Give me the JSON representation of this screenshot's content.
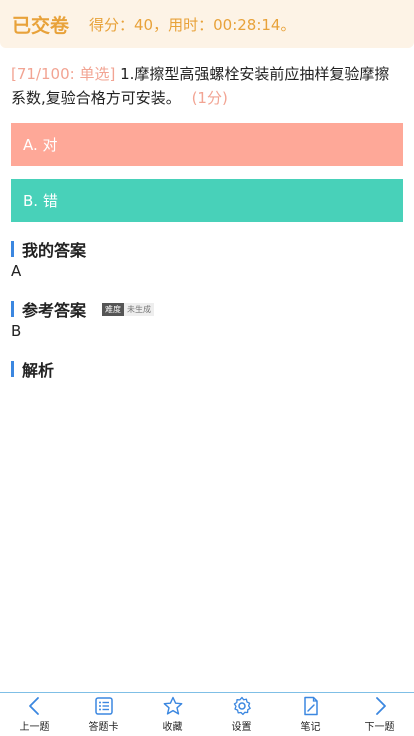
{
  "header": {
    "status": "已交卷",
    "summary": "得分：40，用时：00:28:14。"
  },
  "question": {
    "tag": "[71/100: 单选]",
    "text": "1.摩擦型高强螺栓安装前应抽样复验摩擦系数,复验合格方可安装。",
    "score": "(1分)"
  },
  "options": {
    "a": "A. 对",
    "b": "B. 错"
  },
  "my_answer": {
    "title": "我的答案",
    "value": "A"
  },
  "reference_answer": {
    "title": "参考答案",
    "badge_left": "难度",
    "badge_right": "未生成",
    "value": "B"
  },
  "analysis": {
    "title": "解析"
  },
  "nav": {
    "items": [
      {
        "label": "上一题",
        "icon": "chevron-left-icon"
      },
      {
        "label": "答题卡",
        "icon": "list-icon"
      },
      {
        "label": "收藏",
        "icon": "star-icon"
      },
      {
        "label": "设置",
        "icon": "gear-icon"
      },
      {
        "label": "笔记",
        "icon": "note-icon"
      },
      {
        "label": "下一题",
        "icon": "chevron-right-icon"
      }
    ]
  },
  "colors": {
    "accent_orange": "#e8a23a",
    "wrong_option": "#fea898",
    "correct_option": "#48d1b9",
    "section_bar": "#3b87e0",
    "nav_icon": "#3b87e0"
  }
}
